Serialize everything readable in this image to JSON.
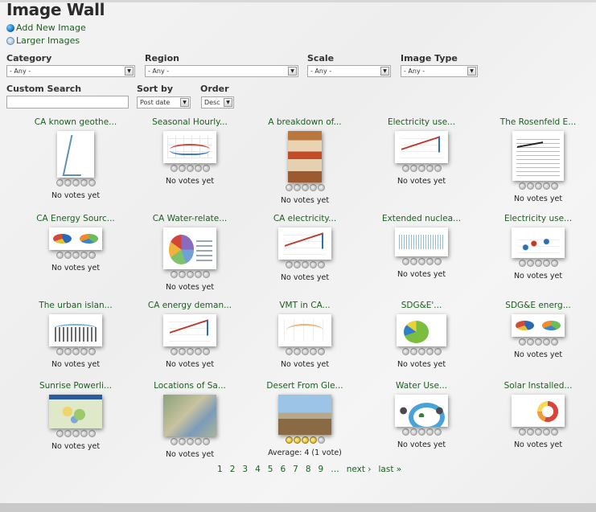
{
  "page": {
    "title": "Image Wall",
    "add_new_image": "Add New Image",
    "larger_images": "Larger Images"
  },
  "filters": {
    "category": {
      "label": "Category",
      "value": "- Any -"
    },
    "region": {
      "label": "Region",
      "value": "- Any -"
    },
    "scale": {
      "label": "Scale",
      "value": "- Any -"
    },
    "image_type": {
      "label": "Image Type",
      "value": "- Any -"
    },
    "custom_search": {
      "label": "Custom Search",
      "value": ""
    },
    "sort_by": {
      "label": "Sort by",
      "value": "Post date"
    },
    "order": {
      "label": "Order",
      "value": "Desc"
    }
  },
  "items": [
    {
      "title": "CA known geothe...",
      "votes": "No votes yet",
      "rating": 0,
      "thumb": "map"
    },
    {
      "title": "Seasonal Hourly...",
      "votes": "No votes yet",
      "rating": 0,
      "thumb": "line"
    },
    {
      "title": "A breakdown of...",
      "votes": "No votes yet",
      "rating": 0,
      "thumb": "poster"
    },
    {
      "title": "Electricity use...",
      "votes": "No votes yet",
      "rating": 0,
      "thumb": "multi"
    },
    {
      "title": "The Rosenfeld E...",
      "votes": "No votes yet",
      "rating": 0,
      "thumb": "table"
    },
    {
      "title": "CA Energy Sourc...",
      "votes": "No votes yet",
      "rating": 0,
      "thumb": "ovals"
    },
    {
      "title": "CA Water-relate...",
      "votes": "No votes yet",
      "rating": 0,
      "thumb": "pie"
    },
    {
      "title": "CA electricity...",
      "votes": "No votes yet",
      "rating": 0,
      "thumb": "multi"
    },
    {
      "title": "Extended nuclea...",
      "votes": "No votes yet",
      "rating": 0,
      "thumb": "noise"
    },
    {
      "title": "Electricity use...",
      "votes": "No votes yet",
      "rating": 0,
      "thumb": "scatter"
    },
    {
      "title": "The urban islan...",
      "votes": "No votes yet",
      "rating": 0,
      "thumb": "bars"
    },
    {
      "title": "CA energy deman...",
      "votes": "No votes yet",
      "rating": 0,
      "thumb": "multi"
    },
    {
      "title": "VMT in CA...",
      "votes": "No votes yet",
      "rating": 0,
      "thumb": "blank"
    },
    {
      "title": "SDG&E'...",
      "votes": "No votes yet",
      "rating": 0,
      "thumb": "bigpie"
    },
    {
      "title": "SDG&E energ...",
      "votes": "No votes yet",
      "rating": 0,
      "thumb": "ovals"
    },
    {
      "title": "Sunrise Powerli...",
      "votes": "No votes yet",
      "rating": 0,
      "thumb": "mapcolor"
    },
    {
      "title": "Locations of Sa...",
      "votes": "No votes yet",
      "rating": 0,
      "thumb": "satmap"
    },
    {
      "title": "Desert From Gle...",
      "votes": "Average: 4 (1 vote)",
      "rating": 4,
      "thumb": "photo"
    },
    {
      "title": "Water Use...",
      "votes": "No votes yet",
      "rating": 0,
      "thumb": "diagram"
    },
    {
      "title": "Solar Installed...",
      "votes": "No votes yet",
      "rating": 0,
      "thumb": "donut"
    }
  ],
  "pager": [
    "1",
    "2",
    "3",
    "4",
    "5",
    "6",
    "7",
    "8",
    "9",
    "…",
    "next ›",
    "last »"
  ]
}
